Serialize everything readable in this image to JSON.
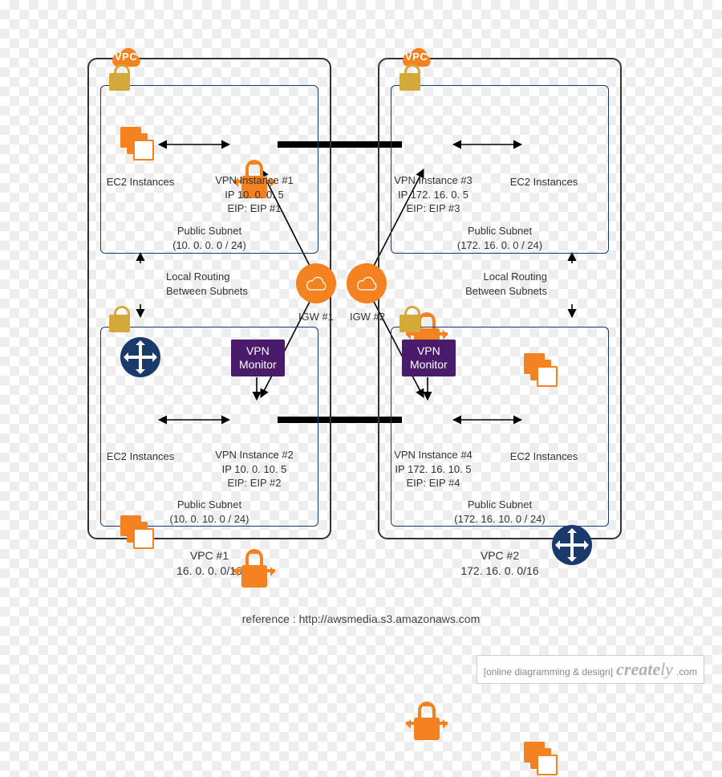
{
  "vpc1": {
    "badge": "VPC",
    "title": "VPC #1",
    "cidr": "16. 0. 0. 0/16",
    "routingLabel": "Local Routing\nBetween Subnets",
    "igwLabel": "IGW #1",
    "subnets": {
      "top": {
        "ec2Label": "EC2 Instances",
        "vpnLabel": "VPN Instance #1\nIP 10. 0. 0. 5\nEIP: EIP #1",
        "subnetLabel": "Public Subnet\n(10. 0. 0. 0 / 24)"
      },
      "bottom": {
        "ec2Label": "EC2 Instances",
        "vpnLabel": "VPN Instance #2\nIP 10. 0. 10. 5\nEIP: EIP #2",
        "monitorLabel": "VPN\nMonitor",
        "subnetLabel": "Public Subnet\n(10. 0. 10. 0 / 24)"
      }
    }
  },
  "vpc2": {
    "badge": "VPC",
    "title": "VPC #2",
    "cidr": "172. 16. 0. 0/16",
    "routingLabel": "Local Routing\nBetween Subnets",
    "igwLabel": "IGW #2",
    "subnets": {
      "top": {
        "ec2Label": "EC2 Instances",
        "vpnLabel": "VPN Instance #3\nIP 172. 16. 0. 5\nEIP: EIP #3",
        "subnetLabel": "Public Subnet\n(172. 16. 0. 0 / 24)"
      },
      "bottom": {
        "ec2Label": "EC2 Instances",
        "vpnLabel": "VPN Instance #4\nIP 172. 16. 10. 5\nEIP: EIP #4",
        "monitorLabel": "VPN\nMonitor",
        "subnetLabel": "Public Subnet\n(172. 16. 10. 0 / 24)"
      }
    }
  },
  "reference": "reference : http://awsmedia.s3.amazonaws.com",
  "footer": {
    "tagline": "[online diagramming & design]",
    "brand1": "create",
    "brand2": "ly",
    "tld": ".com"
  }
}
